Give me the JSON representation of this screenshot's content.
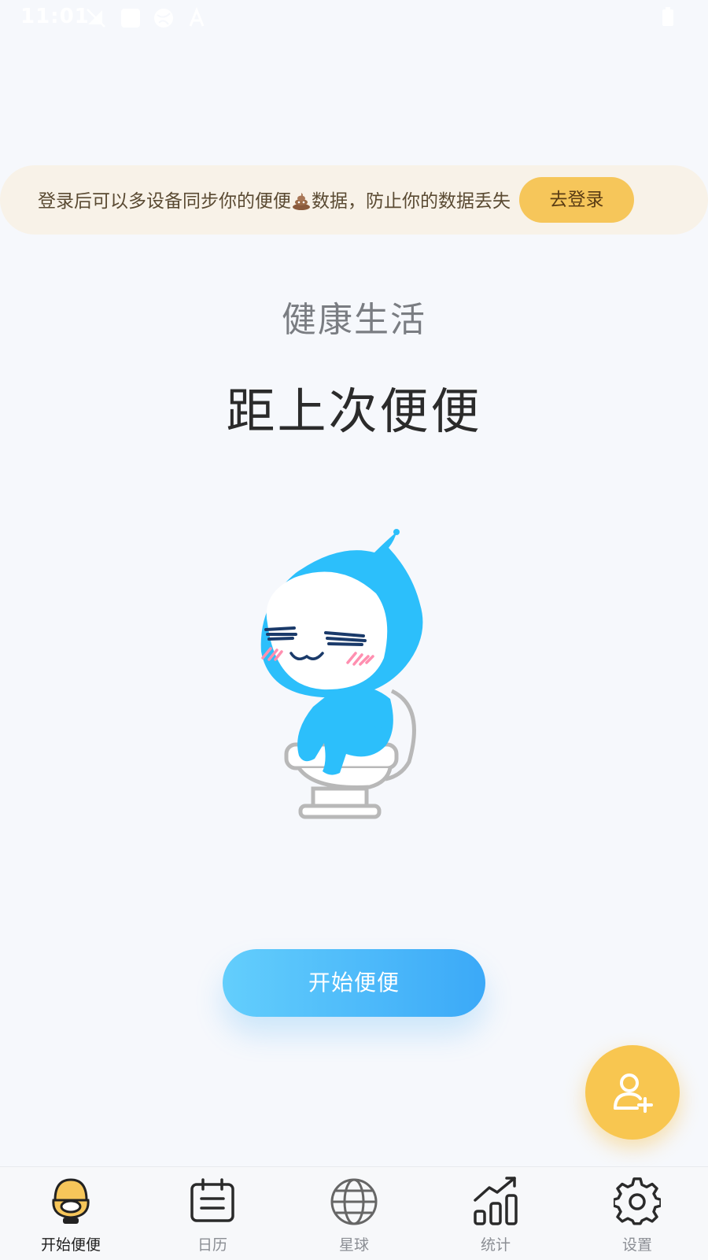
{
  "status_bar": {
    "time": "11:01"
  },
  "banner": {
    "text_before": "登录后可以多设备同步你的便便",
    "emoji_icon": "poop-icon",
    "text_after": "数据，防止你的数据丢失",
    "button_label": "去登录"
  },
  "header": {
    "subtitle": "健康生活",
    "title": "距上次便便"
  },
  "mascot": {
    "icon": "water-drop-mascot-on-toilet"
  },
  "start_button": {
    "label": "开始便便"
  },
  "fab": {
    "icon": "add-user-icon"
  },
  "bottom_nav": {
    "active_index": 0,
    "items": [
      {
        "label": "开始便便",
        "icon": "toilet-icon"
      },
      {
        "label": "日历",
        "icon": "calendar-icon"
      },
      {
        "label": "星球",
        "icon": "globe-icon"
      },
      {
        "label": "统计",
        "icon": "stats-icon"
      },
      {
        "label": "设置",
        "icon": "gear-icon"
      }
    ]
  },
  "colors": {
    "accent_yellow": "#f6c65a",
    "accent_blue": "#3ba9f8",
    "banner_bg": "#f8f2e8",
    "page_bg": "#f6f8fc"
  }
}
